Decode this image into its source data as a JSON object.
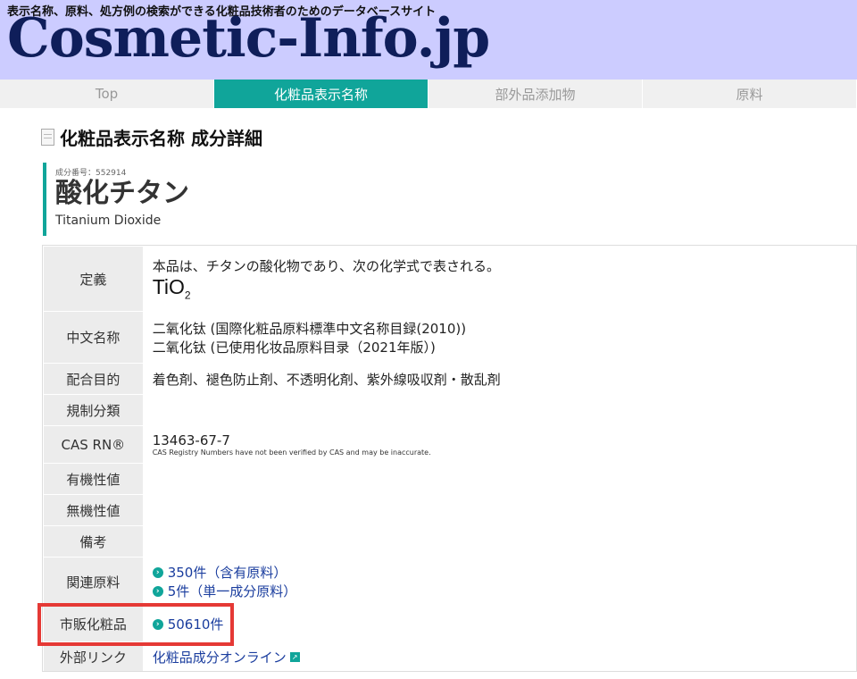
{
  "header": {
    "tagline": "表示名称、原料、処方例の検索ができる化粧品技術者のためのデータベースサイト",
    "logo": "Cosmetic-Info.jp"
  },
  "nav": {
    "items": [
      {
        "label": "Top"
      },
      {
        "label": "化粧品表示名称"
      },
      {
        "label": "部外品添加物"
      },
      {
        "label": "原料"
      }
    ]
  },
  "page": {
    "title": "化粧品表示名称 成分詳細"
  },
  "ingredient": {
    "number_label": "成分番号：552914",
    "name_ja": "酸化チタン",
    "name_en": "Titanium Dioxide"
  },
  "details": {
    "definition": {
      "label": "定義",
      "text": "本品は、チタンの酸化物であり、次の化学式で表される。",
      "formula_main": "TiO",
      "formula_sub": "2"
    },
    "chinese_name": {
      "label": "中文名称",
      "line1": "二氧化钛 (国際化粧品原料標準中文名称目録(2010))",
      "line2": "二氧化钛 (已使用化妆品原料目录（2021年版）)"
    },
    "purpose": {
      "label": "配合目的",
      "value": "着色剤、褪色防止剤、不透明化剤、紫外線吸収剤・散乱剤"
    },
    "regulation": {
      "label": "規制分類",
      "value": ""
    },
    "cas": {
      "label": "CAS RN®",
      "value": "13463-67-7",
      "note": "CAS Registry Numbers have not been verified by CAS and may be inaccurate."
    },
    "organic": {
      "label": "有機性値",
      "value": ""
    },
    "inorganic": {
      "label": "無機性値",
      "value": ""
    },
    "remarks": {
      "label": "備考",
      "value": ""
    },
    "related": {
      "label": "関連原料",
      "link1": "350件（含有原料）",
      "link2": "5件（単一成分原料）"
    },
    "commercial": {
      "label": "市販化粧品",
      "link": "50610件"
    },
    "external": {
      "label": "外部リンク",
      "link": "化粧品成分オンライン"
    }
  }
}
